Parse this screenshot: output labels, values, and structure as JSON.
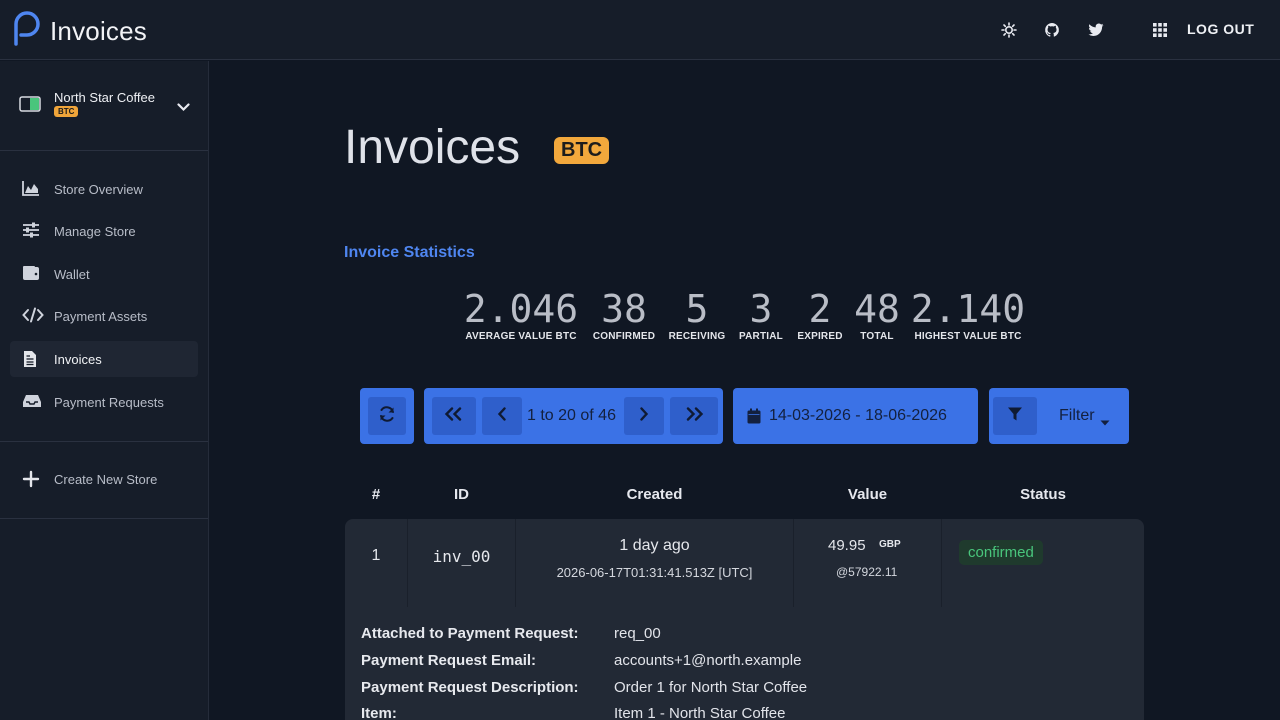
{
  "app": {
    "title": "Invoices"
  },
  "topbar": {
    "logout_label": "LOG OUT"
  },
  "store": {
    "name": "North Star Coffee",
    "badge": "BTC"
  },
  "sidebar": {
    "items": [
      {
        "label": "Store Overview"
      },
      {
        "label": "Manage Store"
      },
      {
        "label": "Wallet"
      },
      {
        "label": "Payment Assets"
      },
      {
        "label": "Invoices"
      },
      {
        "label": "Payment Requests"
      }
    ],
    "create_label": "Create New Store"
  },
  "page": {
    "title": "Invoices",
    "badge": "BTC"
  },
  "stats": {
    "heading": "Invoice Statistics",
    "items": [
      {
        "value": "2.046",
        "label": "AVERAGE VALUE BTC"
      },
      {
        "value": "38",
        "label": "CONFIRMED"
      },
      {
        "value": "5",
        "label": "RECEIVING"
      },
      {
        "value": "3",
        "label": "PARTIAL"
      },
      {
        "value": "2",
        "label": "EXPIRED"
      },
      {
        "value": "48",
        "label": "TOTAL"
      },
      {
        "value": "2.140",
        "label": "HIGHEST VALUE BTC"
      }
    ]
  },
  "toolbar": {
    "pagination_text": "1 to 20 of 46",
    "date_range": "14-03-2026 - 18-06-2026",
    "filter_label": "Filter"
  },
  "table": {
    "headers": [
      "#",
      "ID",
      "Created",
      "Value",
      "Status"
    ],
    "rows": [
      {
        "num": "1",
        "id": "inv_00",
        "created_rel": "1 day ago",
        "created_abs": "2026-06-17T01:31:41.513Z [UTC]",
        "value": "49.95",
        "currency": "GBP",
        "rate": "@57922.11",
        "status": "confirmed",
        "details": [
          {
            "key": "Attached to Payment Request:",
            "value": "req_00"
          },
          {
            "key": "Payment Request Email:",
            "value": "accounts+1@north.example"
          },
          {
            "key": "Payment Request Description:",
            "value": "Order 1 for North Star Coffee"
          },
          {
            "key": "Item:",
            "value": "Item 1 - North Star Coffee"
          }
        ]
      }
    ]
  },
  "colors": {
    "accent": "#3b72e6",
    "brand_badge": "#f2a83c",
    "status_confirmed": "#49c57c"
  }
}
